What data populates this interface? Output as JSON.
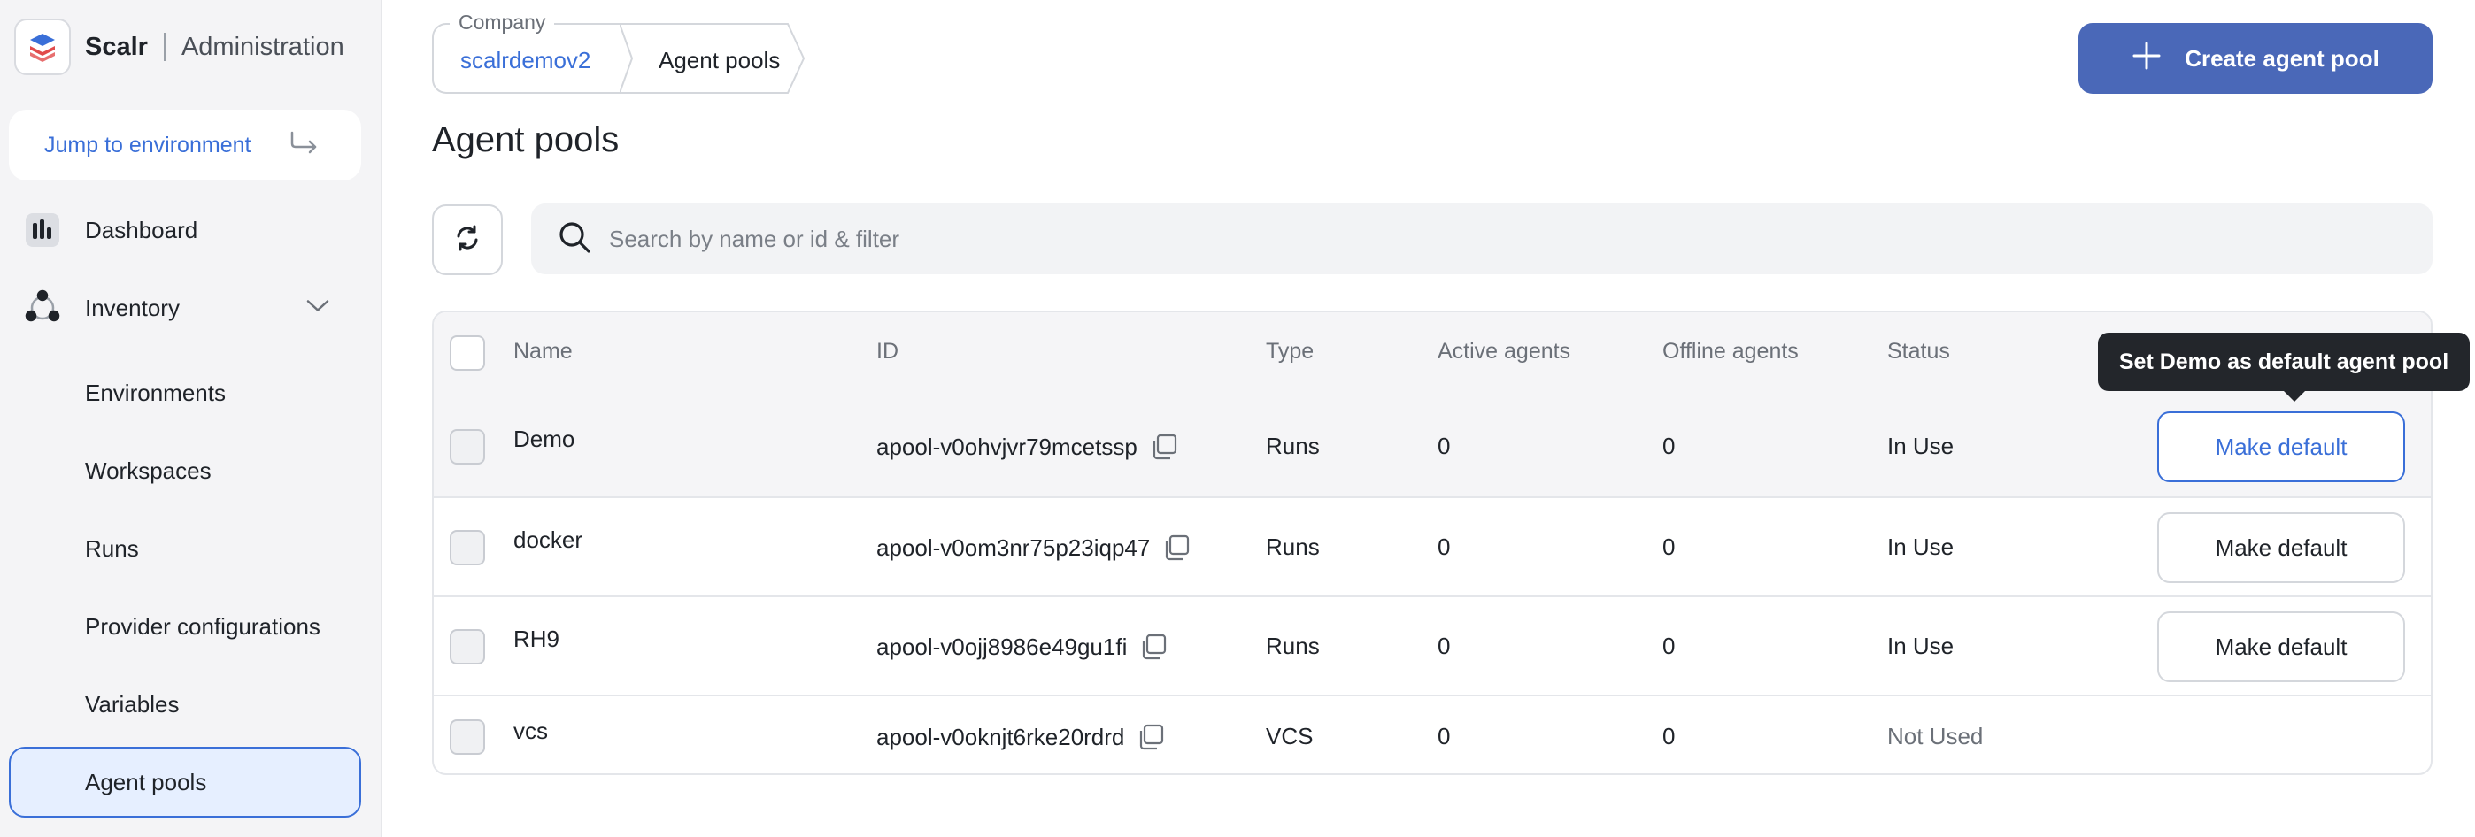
{
  "brand": {
    "name": "Scalr",
    "section": "Administration"
  },
  "sidebar": {
    "jump_label": "Jump to environment",
    "items": [
      {
        "label": "Dashboard",
        "icon": "dashboard-icon"
      },
      {
        "label": "Inventory",
        "icon": "inventory-icon"
      },
      {
        "label": "Environments"
      },
      {
        "label": "Workspaces"
      },
      {
        "label": "Runs"
      },
      {
        "label": "Provider configurations"
      },
      {
        "label": "Variables"
      },
      {
        "label": "Agent pools",
        "active": true
      }
    ]
  },
  "breadcrumb": {
    "company_legend": "Company",
    "company": "scalrdemov2",
    "current": "Agent pools"
  },
  "header": {
    "create_label": "Create agent pool",
    "page_title": "Agent pools"
  },
  "search": {
    "placeholder": "Search by name or id & filter"
  },
  "table": {
    "columns": [
      "Name",
      "ID",
      "Type",
      "Active agents",
      "Offline agents",
      "Status"
    ],
    "rows": [
      {
        "name": "Demo",
        "id": "apool-v0ohvjvr79mcetssp",
        "type": "Runs",
        "active": "0",
        "offline": "0",
        "status": "In Use",
        "action": "Make default"
      },
      {
        "name": "docker",
        "id": "apool-v0om3nr75p23iqp47",
        "type": "Runs",
        "active": "0",
        "offline": "0",
        "status": "In Use",
        "action": "Make default"
      },
      {
        "name": "RH9",
        "id": "apool-v0ojj8986e49gu1fi",
        "type": "Runs",
        "active": "0",
        "offline": "0",
        "status": "In Use",
        "action": "Make default"
      },
      {
        "name": "vcs",
        "id": "apool-v0oknjt6rke20rdrd",
        "type": "VCS",
        "active": "0",
        "offline": "0",
        "status": "Not Used"
      }
    ]
  },
  "tooltip": {
    "text": "Set Demo as default agent pool"
  },
  "colors": {
    "accent": "#3a6fd8",
    "primary_button": "#4a68b8",
    "tooltip_bg": "#23262b"
  }
}
